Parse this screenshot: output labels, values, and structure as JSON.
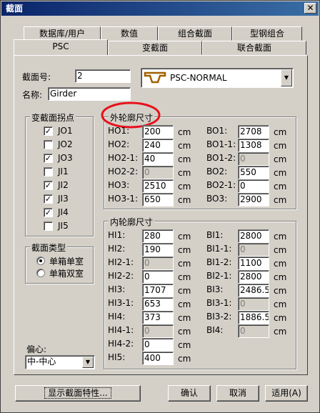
{
  "window": {
    "title": "截面",
    "close_label": "✕"
  },
  "tabs_row1": [
    "数据库/用户",
    "数值",
    "组合截面",
    "型钢组合"
  ],
  "tabs_row2": [
    "PSC",
    "变截面",
    "联合截面"
  ],
  "section": {
    "number_label": "截面号:",
    "number_value": "2",
    "name_label": "名称:",
    "name_value": "Girder",
    "type_value": "PSC-NORMAL"
  },
  "break_points": {
    "title": "变截面拐点",
    "items": [
      {
        "label": "JO1",
        "checked": true
      },
      {
        "label": "JO2",
        "checked": false
      },
      {
        "label": "JO3",
        "checked": true
      },
      {
        "label": "JI1",
        "checked": false
      },
      {
        "label": "JI2",
        "checked": true
      },
      {
        "label": "JI3",
        "checked": true
      },
      {
        "label": "JI4",
        "checked": true
      },
      {
        "label": "JI5",
        "checked": false
      }
    ]
  },
  "section_type": {
    "title": "截面类型",
    "options": [
      {
        "label": "单箱单室",
        "selected": true
      },
      {
        "label": "单箱双室",
        "selected": false
      }
    ]
  },
  "eccentricity": {
    "label": "偏心:",
    "value": "中-中心"
  },
  "unit": "cm",
  "outer": {
    "title": "外轮廓尺寸",
    "left": [
      {
        "label": "HO1:",
        "value": "200",
        "enabled": true
      },
      {
        "label": "HO2:",
        "value": "240",
        "enabled": true
      },
      {
        "label": "HO2-1:",
        "value": "40",
        "enabled": true
      },
      {
        "label": "HO2-2:",
        "value": "0",
        "enabled": false
      },
      {
        "label": "HO3:",
        "value": "2510",
        "enabled": true
      },
      {
        "label": "HO3-1:",
        "value": "650",
        "enabled": true
      }
    ],
    "right": [
      {
        "label": "BO1:",
        "value": "2708",
        "enabled": true
      },
      {
        "label": "BO1-1:",
        "value": "1308",
        "enabled": true
      },
      {
        "label": "BO1-2:",
        "value": "0",
        "enabled": false
      },
      {
        "label": "BO2:",
        "value": "550",
        "enabled": true
      },
      {
        "label": "BO2-1:",
        "value": "0",
        "enabled": true
      },
      {
        "label": "BO3:",
        "value": "2900",
        "enabled": true
      }
    ]
  },
  "inner": {
    "title": "内轮廓尺寸",
    "left": [
      {
        "label": "HI1:",
        "value": "280",
        "enabled": true
      },
      {
        "label": "HI2:",
        "value": "190",
        "enabled": true
      },
      {
        "label": "HI2-1:",
        "value": "0",
        "enabled": false
      },
      {
        "label": "HI2-2:",
        "value": "0",
        "enabled": true
      },
      {
        "label": "HI3:",
        "value": "1707",
        "enabled": true
      },
      {
        "label": "HI3-1:",
        "value": "653",
        "enabled": true
      },
      {
        "label": "HI4:",
        "value": "373",
        "enabled": true
      },
      {
        "label": "HI4-1:",
        "value": "0",
        "enabled": false
      },
      {
        "label": "HI4-2:",
        "value": "0",
        "enabled": true
      },
      {
        "label": "HI5:",
        "value": "400",
        "enabled": true
      }
    ],
    "right": [
      {
        "label": "BI1:",
        "value": "2800",
        "enabled": true
      },
      {
        "label": "BI1-1:",
        "value": "0",
        "enabled": false
      },
      {
        "label": "BI1-2:",
        "value": "1100",
        "enabled": true
      },
      {
        "label": "BI2-1:",
        "value": "2800",
        "enabled": true
      },
      {
        "label": "BI3:",
        "value": "2486.5",
        "enabled": true
      },
      {
        "label": "BI3-1:",
        "value": "0",
        "enabled": false
      },
      {
        "label": "BI3-2:",
        "value": "1886.5",
        "enabled": true
      },
      {
        "label": "BI4:",
        "value": "0",
        "enabled": false
      }
    ]
  },
  "buttons": {
    "show_props": "显示截面特性...",
    "ok": "确认",
    "cancel": "取消",
    "apply": "适用(A)"
  },
  "colors": {
    "highlight_circle": "#e8101a",
    "titlebar": "#0a246a"
  }
}
